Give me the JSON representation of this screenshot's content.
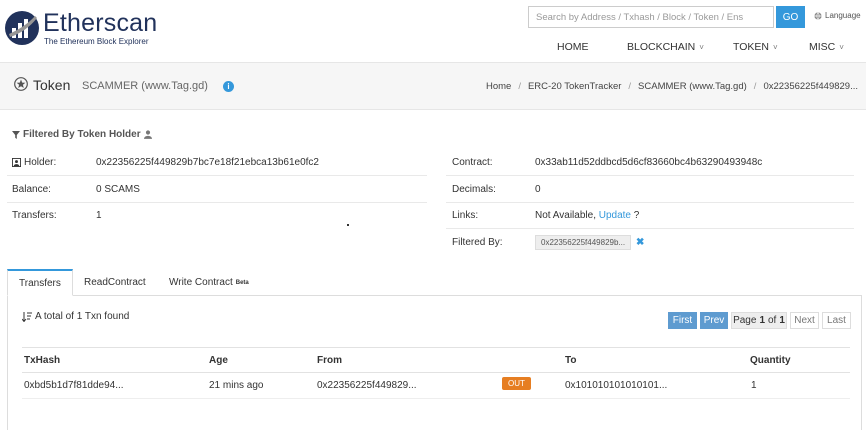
{
  "brand": {
    "name": "Etherscan",
    "tagline": "The Ethereum Block Explorer",
    "accent_color": "#3498db",
    "logo_color": "#21325b"
  },
  "search": {
    "placeholder": "Search by Address / Txhash / Block / Token / Ens",
    "button_label": "GO"
  },
  "language": {
    "label": "Language",
    "icon": "globe-icon"
  },
  "nav": {
    "items": [
      {
        "label": "HOME",
        "has_dropdown": false
      },
      {
        "label": "BLOCKCHAIN",
        "has_dropdown": true
      },
      {
        "label": "TOKEN",
        "has_dropdown": true
      },
      {
        "label": "MISC",
        "has_dropdown": true
      }
    ]
  },
  "page": {
    "title": "Token",
    "token_name": "SCAMMER (www.Tag.gd)",
    "icon": "token-icon",
    "info_icon": "info-icon"
  },
  "breadcrumb": [
    "Home",
    "ERC-20 TokenTracker",
    "SCAMMER (www.Tag.gd)",
    "0x22356225f449829..."
  ],
  "filter": {
    "heading": "Filtered By Token Holder",
    "left": {
      "holder_label": "Holder:",
      "holder_value": "0x22356225f449829b7bc7e18f21ebca13b61e0fc2",
      "balance_label": "Balance:",
      "balance_value": "0 SCAMS",
      "transfers_label": "Transfers:",
      "transfers_value": "1"
    },
    "right": {
      "contract_label": "Contract:",
      "contract_value": "0x33ab11d52ddbcd5d6cf83660bc4b63290493948c",
      "decimals_label": "Decimals:",
      "decimals_value": "0",
      "links_label": "Links:",
      "links_text": "Not Available,",
      "links_update": "Update",
      "links_suffix": "?",
      "filtered_label": "Filtered By:",
      "filtered_value": "0x22356225f449829b..."
    }
  },
  "tabs": [
    {
      "label": "Transfers",
      "active": true
    },
    {
      "label": "ReadContract",
      "active": false
    },
    {
      "label": "Write Contract",
      "badge": "Beta",
      "active": false
    }
  ],
  "transfers": {
    "summary": "A total of 1 Txn found",
    "pagination": {
      "first": "First",
      "prev": "Prev",
      "page_prefix": "Page",
      "current": "1",
      "of": "of",
      "total": "1",
      "next": "Next",
      "last": "Last"
    },
    "columns": [
      "TxHash",
      "Age",
      "From",
      "To",
      "Quantity"
    ],
    "rows": [
      {
        "txhash": "0xbd5b1d7f81dde94...",
        "age": "21 mins ago",
        "from": "0x22356225f449829...",
        "direction": "OUT",
        "to": "0x101010101010101...",
        "quantity": "1"
      }
    ]
  }
}
